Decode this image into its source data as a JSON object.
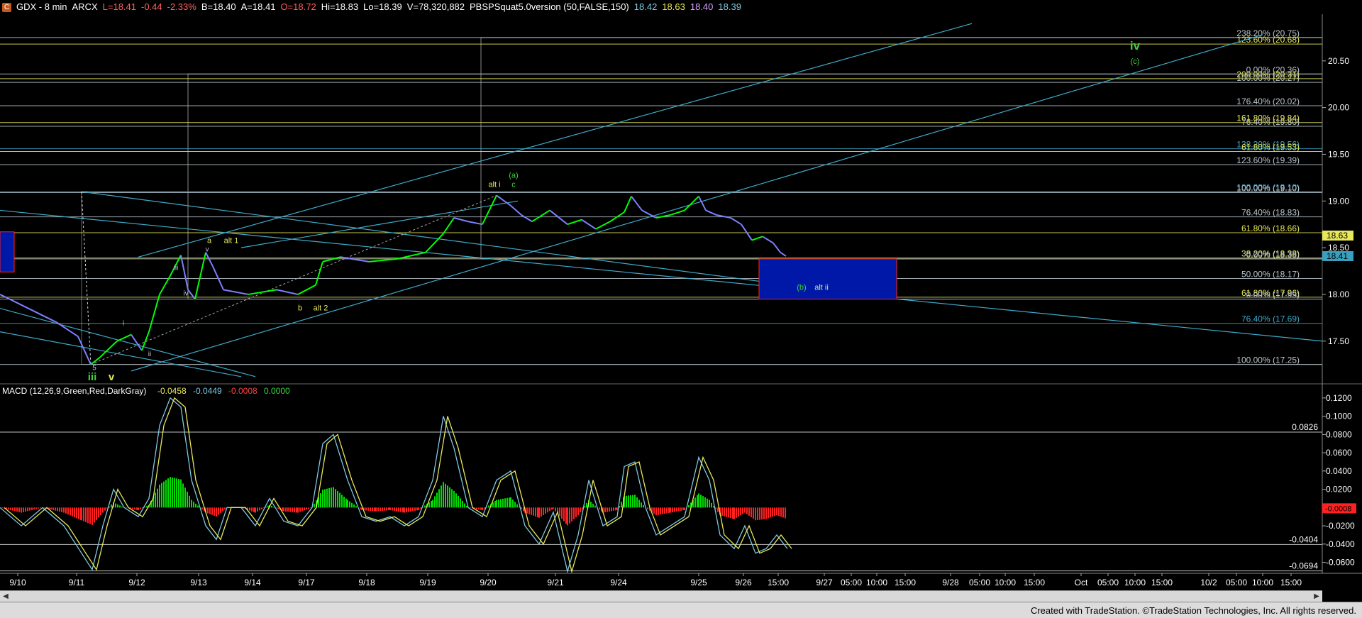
{
  "header": {
    "icon_letter": "C",
    "symbol": "GDX - 8 min",
    "exchange": "ARCX",
    "items": [
      {
        "text": "L=18.41",
        "color": "#ff6060"
      },
      {
        "text": "-0.44",
        "color": "#ff6060"
      },
      {
        "text": "-2.33%",
        "color": "#ff6060"
      },
      {
        "text": "B=18.40",
        "color": "#ffffff"
      },
      {
        "text": "A=18.41",
        "color": "#ffffff"
      },
      {
        "text": "O=18.72",
        "color": "#ff6060"
      },
      {
        "text": "Hi=18.83",
        "color": "#ffffff"
      },
      {
        "text": "Lo=18.39",
        "color": "#ffffff"
      },
      {
        "text": "V=78,320,882",
        "color": "#ffffff"
      },
      {
        "text": "PBSPSquat5.0version (50,FALSE,150)",
        "color": "#ffffff"
      },
      {
        "text": "18.42",
        "color": "#7ec8e3"
      },
      {
        "text": "18.63",
        "color": "#e8e85a"
      },
      {
        "text": "18.40",
        "color": "#d7a0ff"
      },
      {
        "text": "18.39",
        "color": "#7ec8e3"
      }
    ]
  },
  "macd_header": {
    "label": "MACD (12,26,9,Green,Red,DarkGray)",
    "items": [
      {
        "text": "-0.0458",
        "color": "#e8e85a"
      },
      {
        "text": "-0.0449",
        "color": "#7ec8e3"
      },
      {
        "text": "-0.0008",
        "color": "#ff4040"
      },
      {
        "text": "0.0000",
        "color": "#3cd43c"
      }
    ]
  },
  "footer": {
    "text": "Created with TradeStation. ©TradeStation Technologies, Inc. All rights reserved."
  },
  "colors": {
    "up": "#00ff00",
    "down": "#7f7fff",
    "fib": "#b8c4cc",
    "trend": "#3fa9c9",
    "macd_pos": "#00dd00",
    "macd_neg": "#ff2020",
    "signal": "#e8e85a",
    "macd_line": "#7ec8e3"
  },
  "chart_data": [
    {
      "type": "line",
      "title": "GDX - 8 min",
      "ylim": [
        17.05,
        21.0
      ],
      "y_ticks": [
        "20.50",
        "20.00",
        "19.50",
        "19.00",
        "18.50",
        "18.00",
        "17.50"
      ],
      "x_ticks": [
        "9/10",
        "9/11",
        "9/12",
        "9/13",
        "9/14",
        "9/17",
        "9/18",
        "9/19",
        "9/20",
        "9/21",
        "9/24",
        "9/25",
        "9/26",
        "15:00",
        "9/27",
        "05:00",
        "10:00",
        "15:00",
        "9/28",
        "05:00",
        "10:00",
        "15:00",
        "Oct",
        "05:00",
        "10:00",
        "15:00",
        "10/2",
        "05:00",
        "10:00",
        "15:00"
      ],
      "price_path": [
        [
          0,
          18.0
        ],
        [
          40,
          17.85
        ],
        [
          80,
          17.7
        ],
        [
          110,
          17.55
        ],
        [
          128,
          17.25
        ],
        [
          140,
          17.32
        ],
        [
          165,
          17.5
        ],
        [
          185,
          17.57
        ],
        [
          200,
          17.4
        ],
        [
          210,
          17.6
        ],
        [
          225,
          18.0
        ],
        [
          240,
          18.2
        ],
        [
          255,
          18.42
        ],
        [
          265,
          18.05
        ],
        [
          275,
          17.95
        ],
        [
          290,
          18.45
        ],
        [
          300,
          18.3
        ],
        [
          315,
          18.05
        ],
        [
          350,
          18.0
        ],
        [
          390,
          18.05
        ],
        [
          420,
          18.0
        ],
        [
          445,
          18.1
        ],
        [
          455,
          18.35
        ],
        [
          480,
          18.4
        ],
        [
          520,
          18.35
        ],
        [
          560,
          18.38
        ],
        [
          600,
          18.45
        ],
        [
          625,
          18.65
        ],
        [
          640,
          18.82
        ],
        [
          660,
          18.78
        ],
        [
          680,
          18.75
        ],
        [
          700,
          19.06
        ],
        [
          720,
          18.95
        ],
        [
          735,
          18.85
        ],
        [
          750,
          18.78
        ],
        [
          775,
          18.9
        ],
        [
          800,
          18.75
        ],
        [
          820,
          18.8
        ],
        [
          840,
          18.7
        ],
        [
          860,
          18.78
        ],
        [
          880,
          18.88
        ],
        [
          890,
          19.05
        ],
        [
          905,
          18.9
        ],
        [
          925,
          18.82
        ],
        [
          945,
          18.85
        ],
        [
          965,
          18.9
        ],
        [
          985,
          19.05
        ],
        [
          995,
          18.9
        ],
        [
          1010,
          18.85
        ],
        [
          1030,
          18.82
        ],
        [
          1045,
          18.75
        ],
        [
          1060,
          18.58
        ],
        [
          1075,
          18.62
        ],
        [
          1090,
          18.55
        ],
        [
          1100,
          18.45
        ],
        [
          1108,
          18.41
        ]
      ],
      "current_price": {
        "label": "18.41",
        "value": 18.41,
        "color": "#3aa0c0"
      },
      "marker_price": {
        "label": "18.63",
        "value": 18.63,
        "color": "#e8e85a"
      },
      "fib_levels": [
        {
          "label": "238.20% (20.75)",
          "value": 20.75,
          "color": "#b8c4cc"
        },
        {
          "label": "123.60% (20.68)",
          "value": 20.68,
          "color": "#e8e85a"
        },
        {
          "label": "0.00% (20.36)",
          "value": 20.36,
          "color": "#b8c4cc"
        },
        {
          "label": "200.00% (20.31)",
          "value": 20.31,
          "color": "#e8e85a"
        },
        {
          "label": "100.00% (20.27)",
          "value": 20.27,
          "color": "#b8c4cc"
        },
        {
          "label": "176.40% (20.02)",
          "value": 20.02,
          "color": "#b8c4cc"
        },
        {
          "label": "161.80% (19.84)",
          "value": 19.84,
          "color": "#e8e85a"
        },
        {
          "label": "76.40% (19.80)",
          "value": 19.8,
          "color": "#b8c4cc"
        },
        {
          "label": "138.20% (19.56)",
          "value": 19.56,
          "color": "#3fa9c9"
        },
        {
          "label": "61.80% (19.53)",
          "value": 19.53,
          "color": "#e8e85a"
        },
        {
          "label": "123.60% (19.39)",
          "value": 19.39,
          "color": "#b8c4cc"
        },
        {
          "label": "100.00% (19.10)",
          "value": 19.1,
          "color": "#3fa9c9"
        },
        {
          "label": "100.00% (19.10)",
          "value": 19.09,
          "color": "#b8c4cc"
        },
        {
          "label": "76.40% (18.83)",
          "value": 18.83,
          "color": "#b8c4cc"
        },
        {
          "label": "61.80% (18.66)",
          "value": 18.66,
          "color": "#e8e85a"
        },
        {
          "label": "38.20% (18.38)",
          "value": 18.39,
          "color": "#e8e85a"
        },
        {
          "label": "0.00% (18.38)",
          "value": 18.38,
          "color": "#b8c4cc"
        },
        {
          "label": "50.00% (18.17)",
          "value": 18.17,
          "color": "#b8c4cc"
        },
        {
          "label": "61.80% (17.96)",
          "value": 17.97,
          "color": "#e8e85a"
        },
        {
          "label": "0.00% (17.95)",
          "value": 17.95,
          "color": "#b8c4cc"
        },
        {
          "label": "76.40% (17.69)",
          "value": 17.69,
          "color": "#3fa9c9"
        },
        {
          "label": "100.00% (17.25)",
          "value": 17.25,
          "color": "#b8c4cc"
        }
      ],
      "annotations": [
        {
          "text": "iv",
          "color": "#3cd43c",
          "x": 1600,
          "y": 20.62,
          "size": 17,
          "bold": true
        },
        {
          "text": "(c)",
          "color": "#3cd43c",
          "x": 1600,
          "y": 20.47,
          "size": 11
        },
        {
          "text": "(a)",
          "color": "#3cd43c",
          "x": 724,
          "y": 19.25,
          "size": 11
        },
        {
          "text": "alt i",
          "color": "#e8e85a",
          "x": 697,
          "y": 19.15,
          "size": 11
        },
        {
          "text": "c",
          "color": "#3cd43c",
          "x": 724,
          "y": 19.15,
          "size": 11
        },
        {
          "text": "a",
          "color": "#e8e85a",
          "x": 295,
          "y": 18.55,
          "size": 11
        },
        {
          "text": "alt 1",
          "color": "#e8e85a",
          "x": 326,
          "y": 18.55,
          "size": 11
        },
        {
          "text": "v",
          "color": "#b8c4cc",
          "x": 292,
          "y": 18.46,
          "size": 10
        },
        {
          "text": "iii",
          "color": "#b8c4cc",
          "x": 248,
          "y": 18.26,
          "size": 10
        },
        {
          "text": "iv",
          "color": "#b8c4cc",
          "x": 262,
          "y": 17.99,
          "size": 10
        },
        {
          "text": "i",
          "color": "#b8c4cc",
          "x": 174,
          "y": 17.67,
          "size": 10
        },
        {
          "text": "ii",
          "color": "#b8c4cc",
          "x": 211,
          "y": 17.34,
          "size": 10
        },
        {
          "text": "b",
          "color": "#e8e85a",
          "x": 423,
          "y": 17.83,
          "size": 11
        },
        {
          "text": "alt 2",
          "color": "#e8e85a",
          "x": 452,
          "y": 17.83,
          "size": 11
        },
        {
          "text": "(b)",
          "color": "#3cd43c",
          "x": 1130,
          "y": 18.05,
          "size": 11
        },
        {
          "text": "alt ii",
          "color": "#e8e85a",
          "x": 1158,
          "y": 18.05,
          "size": 11
        },
        {
          "text": "5",
          "color": "#b8c4cc",
          "x": 133,
          "y": 17.19,
          "size": 10
        },
        {
          "text": "iii",
          "color": "#3cd43c",
          "x": 130,
          "y": 17.08,
          "size": 15,
          "bold": true
        },
        {
          "text": "v",
          "color": "#e8e85a",
          "x": 157,
          "y": 17.08,
          "size": 15,
          "bold": true
        }
      ]
    },
    {
      "type": "bar",
      "title": "MACD (12,26,9,Green,Red,DarkGray)",
      "ylim": [
        -0.072,
        0.13
      ],
      "y_ticks": [
        "0.1200",
        "0.1000",
        "0.0800",
        "0.0600",
        "0.0400",
        "0.0200",
        "-0.0200",
        "-0.0400",
        "-0.0600"
      ],
      "levels": [
        {
          "label": "0.0826",
          "value": 0.0826
        },
        {
          "label": "-0.0404",
          "value": -0.0404
        },
        {
          "label": "-0.0694",
          "value": -0.0694
        }
      ],
      "current": {
        "label": "-0.0008",
        "value": -0.0008
      },
      "macd_path": [
        [
          0,
          0.0
        ],
        [
          30,
          -0.02
        ],
        [
          60,
          0.0
        ],
        [
          90,
          -0.02
        ],
        [
          115,
          -0.05
        ],
        [
          130,
          -0.068
        ],
        [
          145,
          -0.02
        ],
        [
          160,
          0.02
        ],
        [
          175,
          0.0
        ],
        [
          195,
          -0.01
        ],
        [
          210,
          0.01
        ],
        [
          225,
          0.09
        ],
        [
          240,
          0.12
        ],
        [
          255,
          0.11
        ],
        [
          270,
          0.03
        ],
        [
          290,
          -0.02
        ],
        [
          305,
          -0.035
        ],
        [
          320,
          0.0
        ],
        [
          340,
          0.0
        ],
        [
          360,
          -0.02
        ],
        [
          380,
          0.01
        ],
        [
          400,
          -0.015
        ],
        [
          420,
          -0.02
        ],
        [
          440,
          0.0
        ],
        [
          455,
          0.07
        ],
        [
          470,
          0.08
        ],
        [
          490,
          0.03
        ],
        [
          510,
          -0.01
        ],
        [
          530,
          -0.015
        ],
        [
          550,
          -0.01
        ],
        [
          570,
          -0.02
        ],
        [
          590,
          -0.01
        ],
        [
          610,
          0.03
        ],
        [
          625,
          0.1
        ],
        [
          640,
          0.065
        ],
        [
          660,
          0.0
        ],
        [
          680,
          -0.01
        ],
        [
          700,
          0.03
        ],
        [
          720,
          0.04
        ],
        [
          740,
          -0.02
        ],
        [
          760,
          -0.04
        ],
        [
          780,
          -0.005
        ],
        [
          800,
          -0.07
        ],
        [
          815,
          -0.03
        ],
        [
          830,
          0.03
        ],
        [
          850,
          -0.02
        ],
        [
          870,
          -0.01
        ],
        [
          880,
          0.045
        ],
        [
          895,
          0.05
        ],
        [
          910,
          0.0
        ],
        [
          925,
          -0.03
        ],
        [
          945,
          -0.02
        ],
        [
          965,
          -0.01
        ],
        [
          985,
          0.055
        ],
        [
          1000,
          0.03
        ],
        [
          1015,
          -0.03
        ],
        [
          1035,
          -0.045
        ],
        [
          1050,
          -0.02
        ],
        [
          1065,
          -0.05
        ],
        [
          1080,
          -0.045
        ],
        [
          1095,
          -0.03
        ],
        [
          1110,
          -0.045
        ]
      ]
    }
  ]
}
